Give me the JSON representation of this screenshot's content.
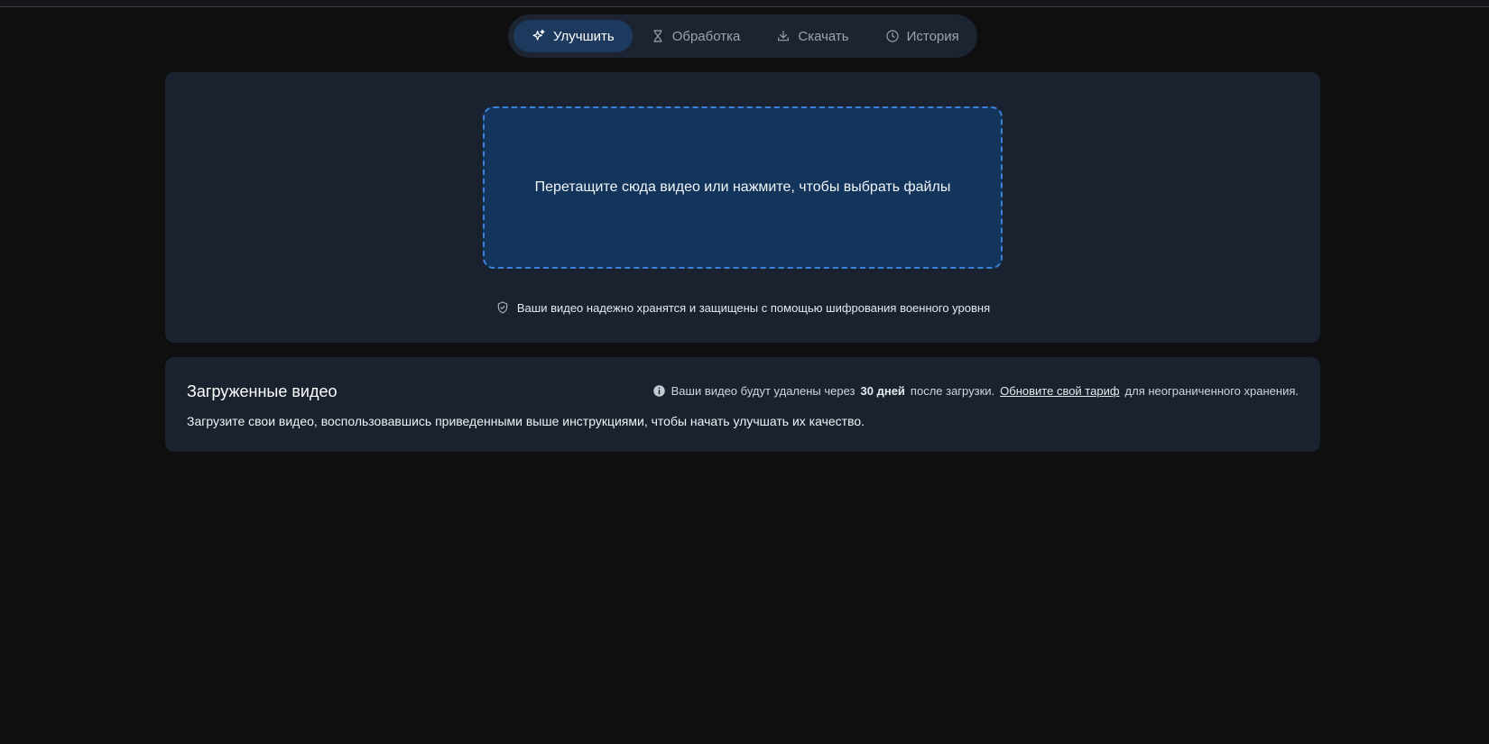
{
  "tabs": [
    {
      "label": "Улучшить",
      "icon": "sparkles-icon",
      "active": true
    },
    {
      "label": "Обработка",
      "icon": "hourglass-icon",
      "active": false
    },
    {
      "label": "Скачать",
      "icon": "download-icon",
      "active": false
    },
    {
      "label": "История",
      "icon": "clock-icon",
      "active": false
    }
  ],
  "upload": {
    "dropzone_text": "Перетащите сюда видео или нажмите, чтобы выбрать файлы",
    "secure_note": "Ваши видео надежно хранятся и защищены с помощью шифрования военного уровня",
    "secure_icon": "shield-check-icon"
  },
  "uploaded": {
    "title": "Загруженные видео",
    "description": "Загрузите свои видео, воспользовавшись приведенными выше инструкциями, чтобы начать улучшать их качество.",
    "retention_prefix": "Ваши видео будут удалены через",
    "retention_days": "30 дней",
    "retention_middle": "после загрузки.",
    "upgrade_link": "Обновите свой тариф",
    "retention_suffix": "для неограниченного хранения.",
    "info_icon": "info-icon"
  },
  "colors": {
    "background": "#0f0f10",
    "card": "#19222e",
    "accent": "#3b82d8",
    "active_tab": "#1d3a5e",
    "dropzone": "#13355c"
  }
}
